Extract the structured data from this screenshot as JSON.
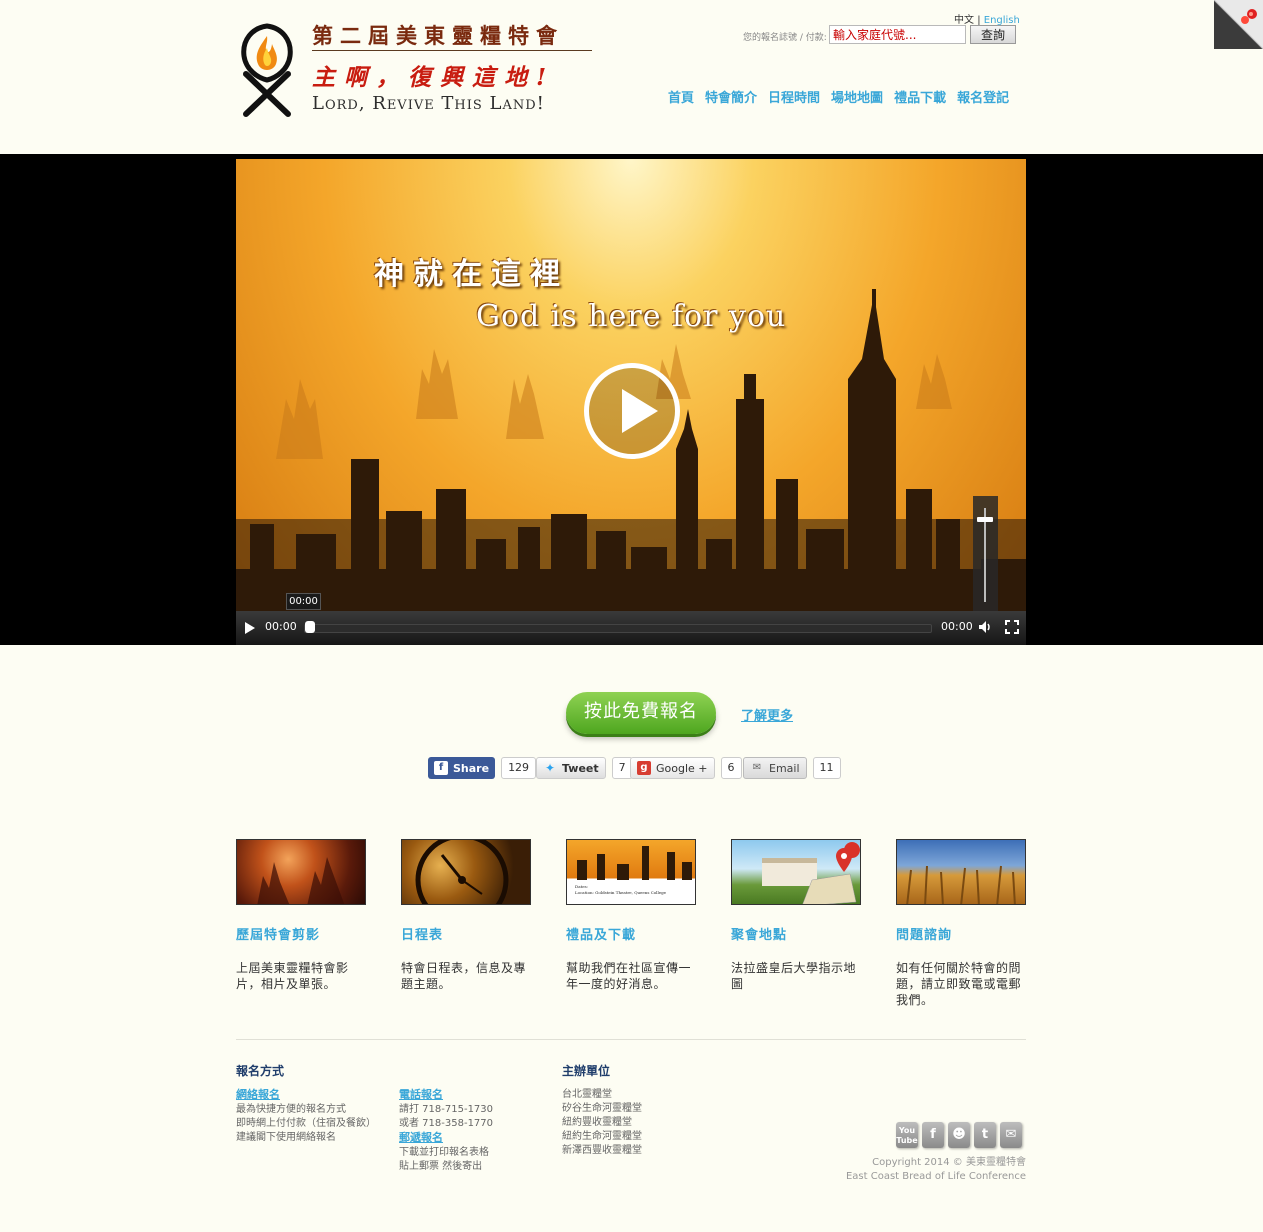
{
  "header": {
    "logo": {
      "title": "第二屆美東靈糧特會",
      "slogan": "主啊，復興這地!",
      "english": "Lord, Revive This Land!"
    },
    "language": {
      "current": "中文",
      "separator": "|",
      "other": "English"
    },
    "search": {
      "label": "您的報名誌號 / 付款:",
      "placeholder": "輸入家庭代號...",
      "button": "查詢"
    },
    "nav": [
      "首頁",
      "特會簡介",
      "日程時間",
      "場地地圖",
      "禮品下載",
      "報名登記"
    ]
  },
  "video": {
    "caption_cn": "神就在這裡",
    "caption_en": "God is here for you",
    "current_time": "00:00",
    "duration": "00:00",
    "tooltip_time": "00:00",
    "progress": 0,
    "volume_level": 0.88
  },
  "cta": {
    "register": "按此免費報名",
    "learn_more": "了解更多"
  },
  "share": {
    "facebook": {
      "label": "Share",
      "count": "129"
    },
    "twitter": {
      "label": "Tweet",
      "count": "7"
    },
    "google": {
      "label": "Google +",
      "count": "6"
    },
    "email": {
      "label": "Email",
      "count": "11"
    }
  },
  "features": [
    {
      "title": "歷屆特會剪影",
      "desc": "上屆美東靈糧特會影片，相片及單張。"
    },
    {
      "title": "日程表",
      "desc": "特會日程表，信息及專題主題。"
    },
    {
      "title": "禮品及下載",
      "desc": "幫助我們在社區宣傳一年一度的好消息。",
      "poster_dates": "Dates:",
      "poster_location": "Location:  Goldstein Theatre, Queens College"
    },
    {
      "title": "聚會地點",
      "desc": "法拉盛皇后大學指示地圖"
    },
    {
      "title": "問題諮詢",
      "desc": "如有任何關於特會的問題，請立即致電或電郵我們。"
    }
  ],
  "footer": {
    "registration_heading": "報名方式",
    "online": {
      "link": "網絡報名",
      "lines": [
        "最為快捷方便的報名方式",
        "即時網上付付款（住宿及餐飲）",
        "建議閣下使用網絡報名"
      ]
    },
    "phone": {
      "link": "電話報名",
      "lines": [
        "請打 718-715-1730",
        "或者 718-358-1770"
      ]
    },
    "mail": {
      "link": "郵遞報名",
      "lines": [
        "下載並打印報名表格",
        "貼上郵票 然後寄出"
      ]
    },
    "organizers_heading": "主辦單位",
    "organizers": [
      "台北靈糧堂",
      "矽谷生命河靈糧堂",
      "紐約豐收靈糧堂",
      "紐約生命河靈糧堂",
      "新澤西豐收靈糧堂"
    ],
    "socials": [
      "youtube-icon",
      "facebook-icon",
      "myspace-icon",
      "twitter-icon",
      "email-icon"
    ],
    "copyright": "Copyright 2014 © 美東靈糧特會",
    "org_english": "East Coast Bread of Life Conference"
  },
  "colors": {
    "link": "#3aa7d8",
    "cta_green": "#5fb82c",
    "background": "#fdfdf3",
    "heading_navy": "#1f3d6b"
  }
}
